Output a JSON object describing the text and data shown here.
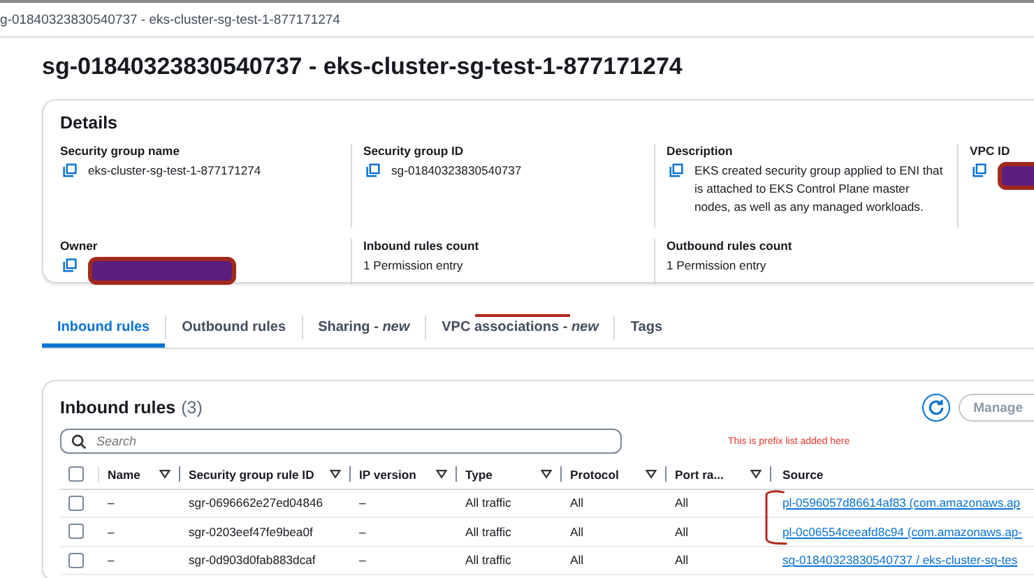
{
  "breadcrumb": "g-01840323830540737 - eks-cluster-sg-test-1-877171274",
  "title": "sg-01840323830540737 - eks-cluster-sg-test-1-877171274",
  "details": {
    "heading": "Details",
    "fields": [
      {
        "label": "Security group name",
        "kind": "copy",
        "value": "eks-cluster-sg-test-1-877171274"
      },
      {
        "label": "Security group ID",
        "kind": "copy",
        "value": "sg-01840323830540737"
      },
      {
        "label": "Description",
        "kind": "copy",
        "value": "EKS created security group applied to ENI that is attached to EKS Control Plane master nodes, as well as any managed workloads."
      },
      {
        "label": "VPC ID",
        "kind": "redacted"
      },
      {
        "label": "Owner",
        "kind": "redacted"
      },
      {
        "label": "Inbound rules count",
        "kind": "plain",
        "value": "1 Permission entry"
      },
      {
        "label": "Outbound rules count",
        "kind": "plain",
        "value": "1 Permission entry"
      }
    ]
  },
  "tabs": [
    {
      "label": "Inbound rules",
      "selected": true,
      "struck": false
    },
    {
      "label": "Outbound rules",
      "selected": false,
      "struck": false
    },
    {
      "label": "Sharing - *new*",
      "selected": false,
      "struck": false
    },
    {
      "label": "VPC associations - *new*",
      "selected": false,
      "struck": true
    },
    {
      "label": "Tags",
      "selected": false,
      "struck": false
    }
  ],
  "rules": {
    "heading": "Inbound rules",
    "count": "(3)",
    "manage_button": "Manage",
    "search": {
      "placeholder": "Search"
    },
    "note": "This is prefix list added here",
    "all_checked": false,
    "columns": [
      {
        "label": "Name",
        "sortable": true
      },
      {
        "label": "Security group rule ID",
        "sortable": true
      },
      {
        "label": "IP version",
        "sortable": true
      },
      {
        "label": "Type",
        "sortable": true
      },
      {
        "label": "Protocol",
        "sortable": true
      },
      {
        "label": "Port ra...",
        "sortable": true
      },
      {
        "label": "Source",
        "sortable": false
      }
    ],
    "rows": [
      {
        "checked": false,
        "cells": [
          "–",
          "sgr-0696662e27ed04846",
          "–",
          "All traffic",
          "All",
          "All"
        ],
        "source": "pl-0596057d86614af83 (com.amazonaws.ap"
      },
      {
        "checked": false,
        "cells": [
          "–",
          "sgr-0203eef47fe9bea0f",
          "–",
          "All traffic",
          "All",
          "All"
        ],
        "source": "pl-0c06554ceeafd8c94 (com.amazonaws.ap-"
      },
      {
        "checked": false,
        "cells": [
          "–",
          "sgr-0d903d0fab883dcaf",
          "–",
          "All traffic",
          "All",
          "All"
        ],
        "source": "sg-01840323830540737 / eks-cluster-sg-tes"
      }
    ]
  }
}
